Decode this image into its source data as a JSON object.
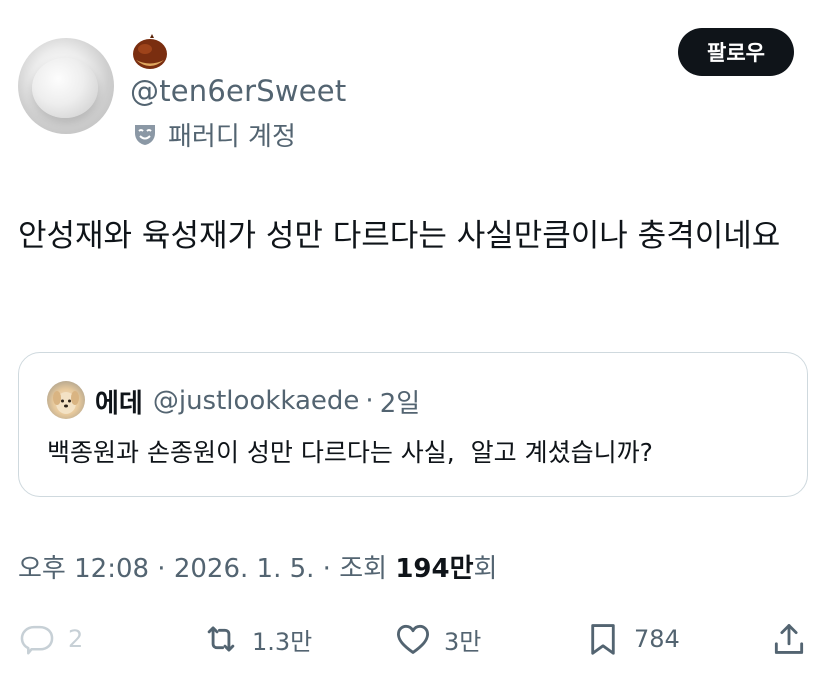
{
  "author": {
    "handle": "@ten6erSweet",
    "parody_label": "패러디 계정",
    "name_icon": "chestnut-emoji",
    "badge_icon": "parody-mask-icon"
  },
  "follow_button": {
    "label": "팔로우"
  },
  "tweet": {
    "text": "안성재와 육성재가 성만 다르다는 사실만큼이나 충격이네요"
  },
  "quoted_tweet": {
    "name": "에데",
    "handle": "@justlookkaede",
    "separator": "·",
    "time": "2일",
    "text": "백종원과 손종원이 성만 다르다는 사실,  알고 계셨습니까?"
  },
  "meta": {
    "time": "오후 12:08",
    "date": "2026. 1. 5.",
    "sep": " · ",
    "views_label": "조회",
    "views_number": "194만",
    "views_suffix": "회"
  },
  "actions": {
    "reply_count": "2",
    "retweet_count": "1.3만",
    "like_count": "3만",
    "bookmark_count": "784"
  },
  "colors": {
    "text": "#0f1419",
    "secondary": "#536471",
    "border": "#cfd9de",
    "button_bg": "#0f1419"
  }
}
